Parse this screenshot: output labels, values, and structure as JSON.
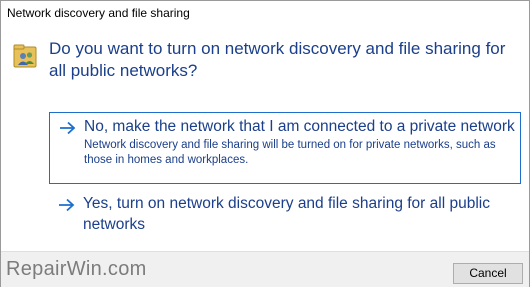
{
  "window": {
    "title": "Network discovery and file sharing"
  },
  "question": {
    "icon": "network-users-icon",
    "text": "Do you want to turn on network discovery and file sharing for all public networks?"
  },
  "options": [
    {
      "icon": "arrow-right-icon",
      "label": "No, make the network that I am connected to a private network",
      "description": "Network discovery and file sharing will be turned on for private networks, such as those in homes and workplaces.",
      "selected": true
    },
    {
      "icon": "arrow-right-icon",
      "label": "Yes, turn on network discovery and file sharing for all public networks",
      "description": "",
      "selected": false
    }
  ],
  "footer": {
    "watermark": "RepairWin.com",
    "cancel_label": "Cancel"
  },
  "colors": {
    "link_text": "#1b3f8a",
    "selection_border": "#1e6fcb",
    "footer_bg": "#f0f0f0"
  }
}
